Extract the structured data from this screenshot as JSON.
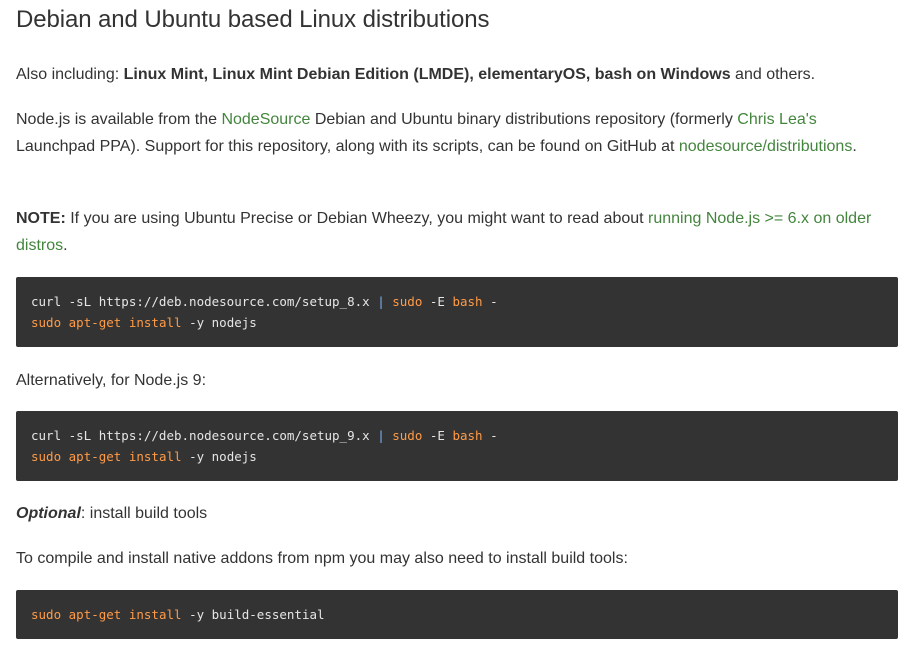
{
  "title": "Debian and Ubuntu based Linux distributions",
  "also": {
    "prefix": "Also including: ",
    "distros": "Linux Mint, Linux Mint Debian Edition (LMDE), elementaryOS, bash on Windows",
    "suffix": " and others."
  },
  "intro": {
    "part1": "Node.js is available from the ",
    "link_nodesource": "NodeSource",
    "part2": " Debian and Ubuntu binary distributions repository (formerly ",
    "link_chris": "Chris Lea's",
    "part3": " Launchpad PPA). Support for this repository, along with its scripts, can be found on GitHub at ",
    "link_repo": "nodesource/distributions",
    "part4": "."
  },
  "note": {
    "label": "NOTE:",
    "text": " If you are using Ubuntu Precise or Debian Wheezy, you might want to read about ",
    "link": "running Node.js >= 6.x on older distros",
    "end": "."
  },
  "code1": {
    "l1_a": "curl -sL https://deb.nodesource.com/setup_8.x ",
    "l1_pipe": "|",
    "l1_sp": " ",
    "l1_sudo": "sudo",
    "l1_e": " -E ",
    "l1_bash": "bash",
    "l1_dash": " -",
    "l2_sudo": "sudo",
    "l2_sp": " ",
    "l2_apt": "apt-get",
    "l2_sp2": " ",
    "l2_install": "install",
    "l2_rest": " -y nodejs"
  },
  "alt_text": "Alternatively, for Node.js 9:",
  "code2": {
    "l1_a": "curl -sL https://deb.nodesource.com/setup_9.x ",
    "l1_pipe": "|",
    "l1_sp": " ",
    "l1_sudo": "sudo",
    "l1_e": " -E ",
    "l1_bash": "bash",
    "l1_dash": " -",
    "l2_sudo": "sudo",
    "l2_sp": " ",
    "l2_apt": "apt-get",
    "l2_sp2": " ",
    "l2_install": "install",
    "l2_rest": " -y nodejs"
  },
  "optional": {
    "label": "Optional",
    "text": ": install build tools"
  },
  "compile_text": "To compile and install native addons from npm you may also need to install build tools:",
  "code3": {
    "sudo": "sudo",
    "sp": " ",
    "apt": "apt-get",
    "sp2": " ",
    "install": "install",
    "rest": " -y build-essential"
  },
  "colors": {
    "link": "#43853d",
    "code_bg": "#333333",
    "code_keyword": "#ff9b47",
    "text": "#333333"
  }
}
